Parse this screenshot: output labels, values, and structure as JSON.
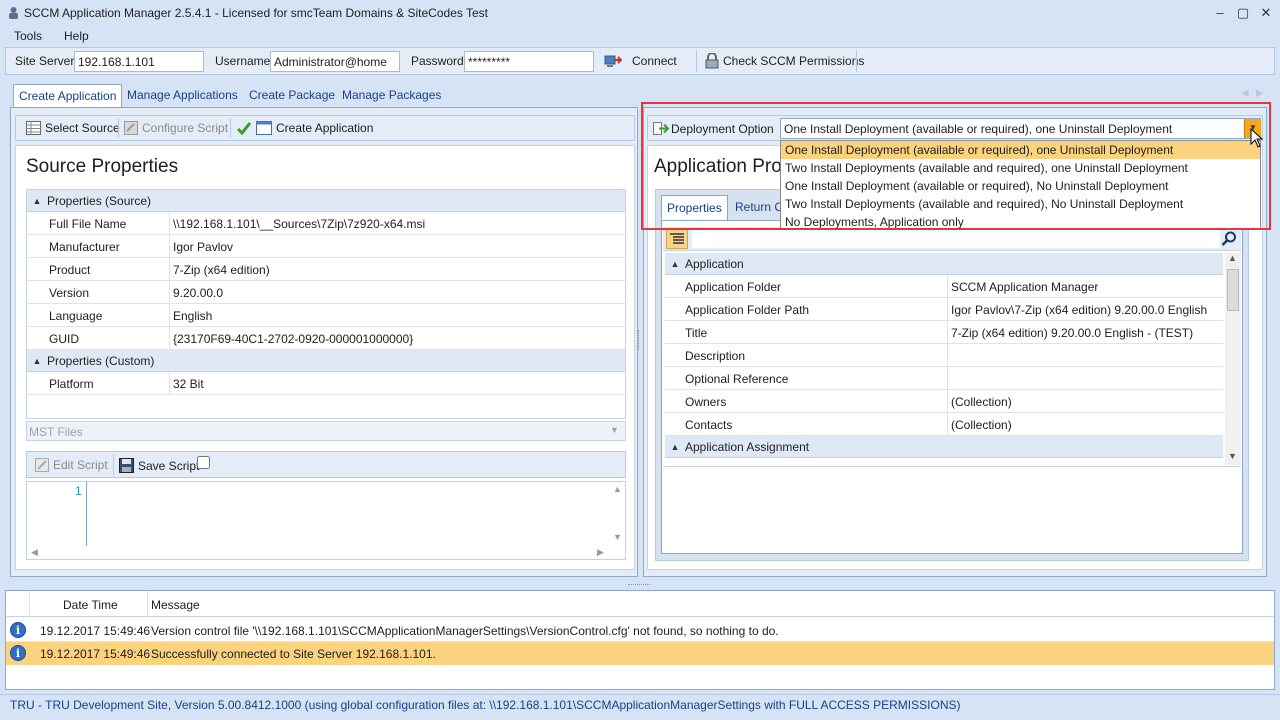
{
  "window": {
    "title": "SCCM Application Manager 2.5.4.1 - Licensed for smcTeam Domains & SiteCodes Test",
    "minimize": "–",
    "maximize": "▢",
    "close": "✕"
  },
  "menu": [
    "Tools",
    "Help"
  ],
  "connection": {
    "site_server_label": "Site Server",
    "site_server_value": "192.168.1.101",
    "username_label": "Username",
    "username_value": "Administrator@home",
    "password_label": "Password",
    "password_value": "*********",
    "connect_label": "Connect",
    "check_permissions_label": "Check SCCM Permissions"
  },
  "tabs": [
    "Create Application",
    "Manage Applications",
    "Create Package",
    "Manage Packages"
  ],
  "left_toolbar": {
    "select_source": "Select Source",
    "configure_script": "Configure Script",
    "create_application": "Create Application"
  },
  "source_properties": {
    "title": "Source Properties",
    "group_source": "Properties (Source)",
    "rows_source": [
      {
        "k": "Full File Name",
        "v": "\\\\192.168.1.101\\__Sources\\7Zip\\7z920-x64.msi"
      },
      {
        "k": "Manufacturer",
        "v": "Igor Pavlov"
      },
      {
        "k": "Product",
        "v": "7-Zip (x64 edition)"
      },
      {
        "k": "Version",
        "v": "9.20.00.0"
      },
      {
        "k": "Language",
        "v": "English"
      },
      {
        "k": "GUID",
        "v": "{23170F69-40C1-2702-0920-000001000000}"
      }
    ],
    "group_custom": "Properties (Custom)",
    "rows_custom": [
      {
        "k": "Platform",
        "v": "32 Bit"
      }
    ],
    "mst_files": "MST Files",
    "edit_script": "Edit Script",
    "save_script": "Save Script",
    "line_number": "1"
  },
  "deployment": {
    "label": "Deployment Option",
    "selected": "One Install Deployment (available or required), one Uninstall Deployment",
    "options": [
      "One Install Deployment (available or required), one Uninstall Deployment",
      "Two Install Deployments (available and required), one Uninstall Deployment",
      "One Install Deployment (available or required), No Uninstall Deployment",
      "Two Install Deployments (available and required), No Uninstall Deployment",
      "No Deployments, Application only"
    ]
  },
  "app_properties": {
    "title": "Application Pro",
    "tabs": [
      "Properties",
      "Return Co"
    ],
    "group_application": "Application",
    "rows": [
      {
        "k": "Application Folder",
        "v": "SCCM Application Manager"
      },
      {
        "k": "Application Folder Path",
        "v": "Igor Pavlov\\7-Zip (x64 edition) 9.20.00.0 English"
      },
      {
        "k": "Title",
        "v": "7-Zip (x64 edition) 9.20.00.0 English - (TEST)"
      },
      {
        "k": "Description",
        "v": ""
      },
      {
        "k": "Optional Reference",
        "v": ""
      },
      {
        "k": "Owners",
        "v": "(Collection)"
      },
      {
        "k": "Contacts",
        "v": "(Collection)"
      }
    ],
    "group_assignment": "Application Assignment"
  },
  "log": {
    "col_datetime": "Date Time",
    "col_message": "Message",
    "rows": [
      {
        "time": "19.12.2017 15:49:46",
        "message": "Version control file '\\\\192.168.1.101\\SCCMApplicationManagerSettings\\VersionControl.cfg' not found, so nothing to do."
      },
      {
        "time": "19.12.2017 15:49:46",
        "message": "Successfully connected to Site Server 192.168.1.101."
      }
    ]
  },
  "status": "TRU - TRU Development Site, Version 5.00.8412.1000 (using global configuration files at: \\\\192.168.1.101\\SCCMApplicationManagerSettings with FULL ACCESS PERMISSIONS)",
  "colors": {
    "highlight_border": "#e0383e",
    "selected_row": "#fbd27e",
    "accent": "#15428b"
  }
}
